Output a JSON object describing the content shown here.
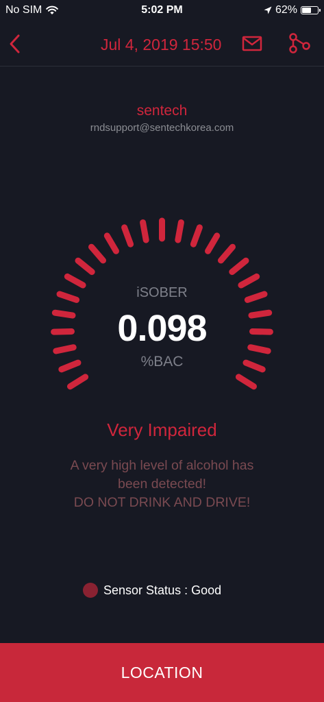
{
  "status_bar": {
    "carrier": "No SIM",
    "time": "5:02 PM",
    "battery_text": "62%",
    "battery_level": 0.62,
    "icons": [
      "wifi-icon",
      "location-arrow-icon",
      "battery-icon"
    ]
  },
  "nav": {
    "date": "Jul 4, 2019 15:50",
    "icons": [
      "back-chevron-icon",
      "mail-icon",
      "share-icon"
    ]
  },
  "user": {
    "name": "sentech",
    "email": "rndsupport@sentechkorea.com"
  },
  "gauge": {
    "label": "iSOBER",
    "value": "0.098",
    "unit": "%BAC",
    "tick_count": 25
  },
  "result": {
    "level": "Very Impaired",
    "message_lines": [
      "A very high level of alcohol has",
      "been detected!",
      "DO NOT DRINK AND DRIVE!"
    ]
  },
  "sensor": {
    "status_text": "Sensor Status : Good"
  },
  "footer": {
    "location_label": "LOCATION"
  },
  "colors": {
    "accent": "#d0263c",
    "background": "#171923",
    "button": "#c8283a",
    "sensor_dot": "#8a2232"
  }
}
